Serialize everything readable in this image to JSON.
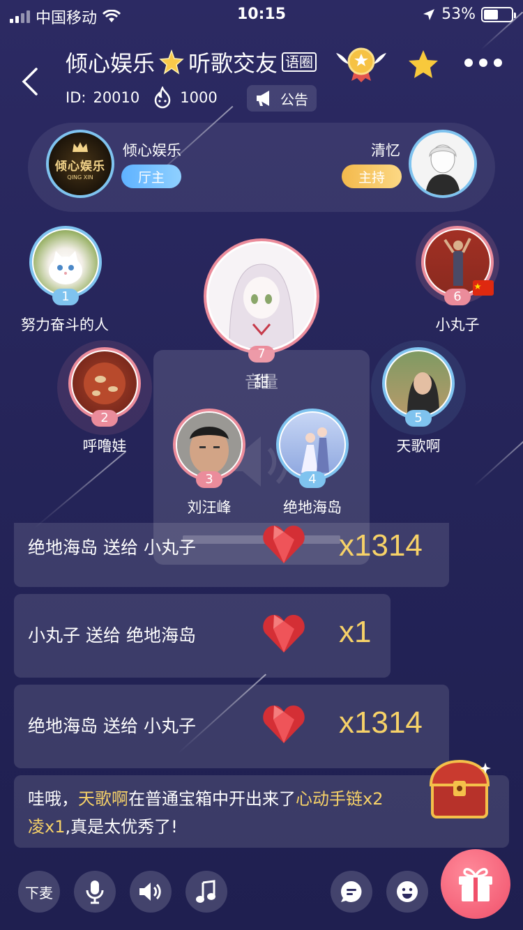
{
  "status_bar": {
    "carrier": "中国移动",
    "time": "10:15",
    "battery": "53%"
  },
  "room": {
    "title_part1": "倾心娱乐",
    "title_part2": "听歌交友",
    "tag": "语圈",
    "id_label": "ID:",
    "id_value": "20010",
    "heat": "1000",
    "notice": "公告"
  },
  "owner": {
    "name": "倾心娱乐",
    "role": "厅主",
    "logo_text": "倾心娱乐",
    "logo_sub": "QING XIN"
  },
  "host": {
    "name": "清忆",
    "role": "主持"
  },
  "seats": [
    {
      "num": "1",
      "name": "努力奋斗的人"
    },
    {
      "num": "2",
      "name": "呼噜娃"
    },
    {
      "num": "3",
      "name": "刘汪峰"
    },
    {
      "num": "4",
      "name": "绝地海岛"
    },
    {
      "num": "5",
      "name": "天歌啊"
    },
    {
      "num": "6",
      "name": "小丸子"
    },
    {
      "num": "7",
      "name": "甜"
    }
  ],
  "volume_overlay": {
    "label": "音量"
  },
  "gift_messages": [
    {
      "sender": "绝地海岛",
      "verb": "送给",
      "receiver": "小丸子",
      "count": "x1314"
    },
    {
      "sender": "小丸子",
      "verb": "送给",
      "receiver": "绝地海岛",
      "count": "x1"
    },
    {
      "sender": "绝地海岛",
      "verb": "送给",
      "receiver": "小丸子",
      "count": "x1314"
    }
  ],
  "system_message": {
    "prefix": "哇哦，",
    "user": "天歌啊",
    "middle": "在普通宝箱中开出来了",
    "item": "心动手链x2",
    "item2": "凌x1",
    "suffix": ",真是太优秀了!"
  },
  "bottom_bar": {
    "leave_mic": "下麦"
  },
  "colors": {
    "accent_gold": "#f7d268",
    "seat_blue": "#7fc3ef",
    "seat_pink": "#eb8c9b",
    "gift_pink": "#f0506a"
  }
}
